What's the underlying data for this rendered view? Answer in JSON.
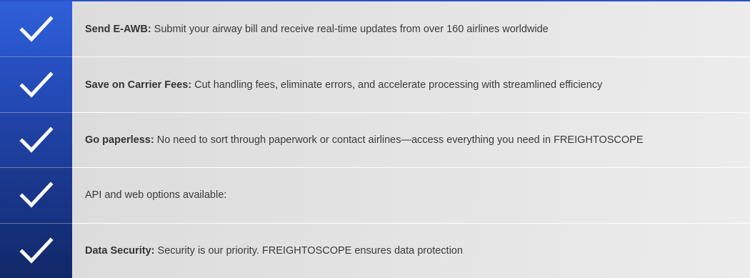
{
  "features": [
    {
      "title": "Send E-AWB:",
      "description": "Submit your airway bill and receive real-time updates from over 160 airlines worldwide"
    },
    {
      "title": "Save on Carrier Fees:",
      "description": "Cut handling fees, eliminate errors, and accelerate processing with streamlined efficiency"
    },
    {
      "title": "Go paperless:",
      "description": "No need to sort through paperwork or contact airlines—access everything you need in FREIGHTOSCOPE"
    },
    {
      "title": "",
      "description": "API and web options available:"
    },
    {
      "title": "Data Security:",
      "description": "Security is our priority. FREIGHTOSCOPE ensures data protection"
    }
  ],
  "colors": {
    "accent": "#2a52c9",
    "check_bg_top": "#2f5fd8",
    "check_bg_bottom": "#112868",
    "text_bg": "#e3e3e3",
    "text": "#3a3a3a"
  },
  "icons": {
    "check": "checkmark-icon"
  }
}
